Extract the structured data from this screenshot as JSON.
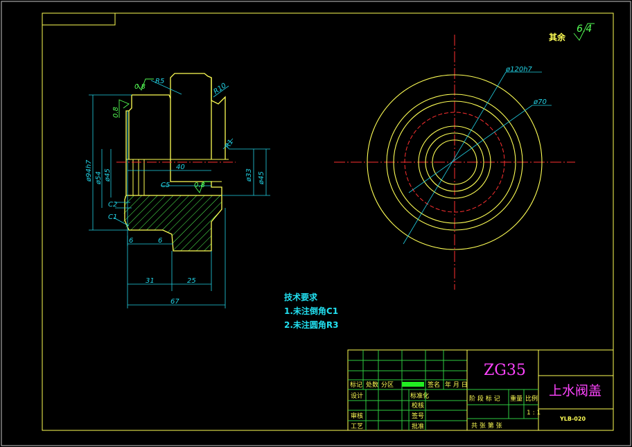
{
  "drawing": {
    "rest_label": "其余",
    "rest_roughness": "6.4",
    "roughness": [
      "0.8",
      "0.8",
      "0.8"
    ],
    "dims": {
      "r5": "R5",
      "r10": "R10",
      "r1": "R1",
      "d94": "ø94h7",
      "d54": "ø54",
      "d45a": "ø45",
      "d33": "ø33",
      "d45b": "ø45",
      "l40": "40",
      "c5": "C5",
      "c2": "C2",
      "c1": "C1",
      "l6a": "6",
      "l6b": "6",
      "l31": "31",
      "l25": "25",
      "l67": "67",
      "d120": "ø120h7",
      "d70": "ø70"
    }
  },
  "notes": {
    "title": "技术要求",
    "items": [
      "1.未注倒角C1",
      "2.未注圆角R3"
    ]
  },
  "title_block": {
    "material": "ZG35",
    "part_name": "上水阀盖",
    "drawing_no": "YLB-020",
    "labels": {
      "mark": "标记",
      "count": "处数",
      "zone": "分区",
      "sign": "签名",
      "date": "年 月 日",
      "design": "设计",
      "standard": "标准化",
      "review": "审核",
      "craft": "工艺",
      "check": "审核",
      "stage_mark": "阶 段 标 记",
      "weight": "重量",
      "scale": "比例",
      "scale_value": "1 : 1",
      "approve": "批准",
      "sheets": "共     张  第     张",
      "doc_no": "签号",
      "proof": "校核"
    }
  }
}
